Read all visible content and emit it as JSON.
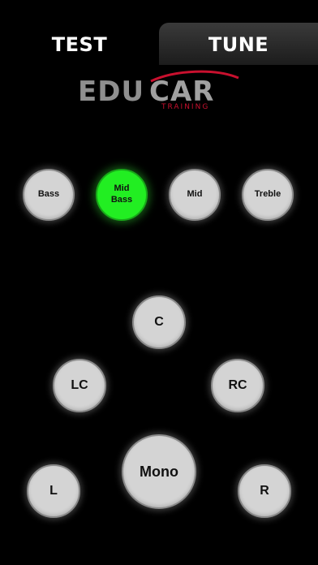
{
  "tabs": {
    "test_label": "TEST",
    "tune_label": "TUNE"
  },
  "logo": {
    "edu": "EDU",
    "car": "CAR",
    "sub": "TRAINING"
  },
  "bands": [
    {
      "label": "Bass",
      "active": false
    },
    {
      "label": "Mid\nBass",
      "active": true
    },
    {
      "label": "Mid",
      "active": false
    },
    {
      "label": "Treble",
      "active": false
    }
  ],
  "speakers": {
    "center": "C",
    "left_center": "LC",
    "right_center": "RC",
    "mono": "Mono",
    "left": "L",
    "right": "R"
  },
  "colors": {
    "background": "#000000",
    "button": "#d4d4d4",
    "active_button": "#22ee22",
    "logo_accent": "#c8102e"
  }
}
